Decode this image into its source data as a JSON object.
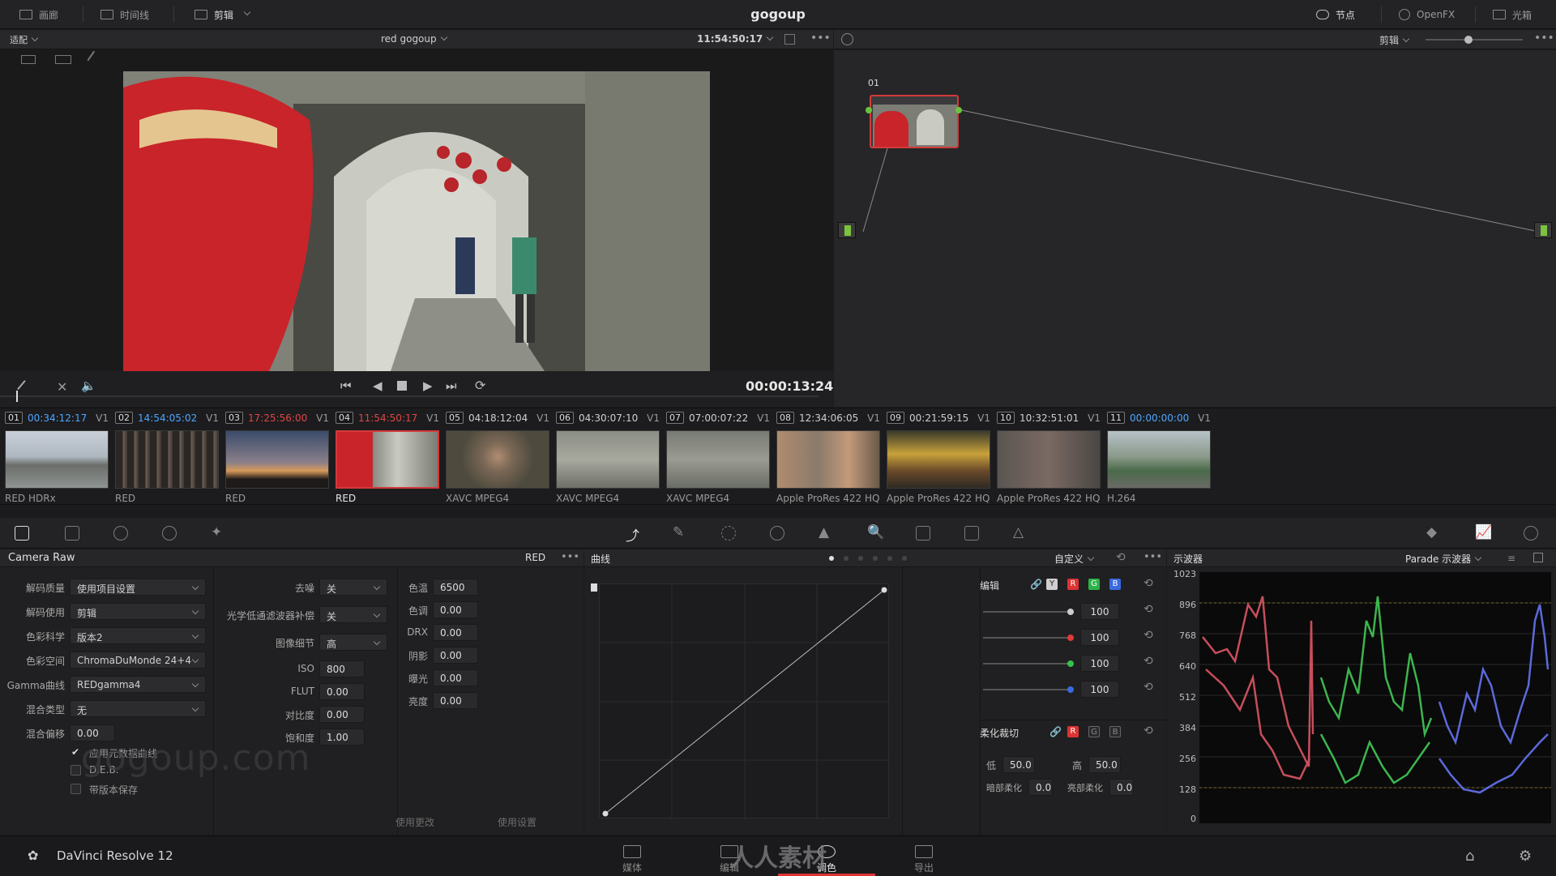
{
  "top_bar": {
    "app_title": "gogoup",
    "left_items": [
      "画廊",
      "时间线"
    ],
    "page_dropdown": "剪辑",
    "right_items": [
      "节点",
      "OpenFX",
      "光箱"
    ]
  },
  "viewer_bar": {
    "fit_label": "适配",
    "clip_name": "red gogoup",
    "timecode": "11:54:50:17"
  },
  "node_bar": {
    "mode_label": "剪辑"
  },
  "node": {
    "label": "01"
  },
  "transport": {
    "timecode": "00:00:13:24"
  },
  "clips": [
    {
      "num": "01",
      "tc": "00:34:12:17",
      "track": "V1",
      "codec": "RED HDRx",
      "tc_color": "#4da6ff"
    },
    {
      "num": "02",
      "tc": "14:54:05:02",
      "track": "V1",
      "codec": "RED",
      "tc_color": "#4da6ff"
    },
    {
      "num": "03",
      "tc": "17:25:56:00",
      "track": "V1",
      "codec": "RED",
      "tc_color": "#e04545"
    },
    {
      "num": "04",
      "tc": "11:54:50:17",
      "track": "V1",
      "codec": "RED",
      "tc_color": "#e04545"
    },
    {
      "num": "05",
      "tc": "04:18:12:04",
      "track": "V1",
      "codec": "XAVC MPEG4",
      "tc_color": "#cfcfcf"
    },
    {
      "num": "06",
      "tc": "04:30:07:10",
      "track": "V1",
      "codec": "XAVC MPEG4",
      "tc_color": "#cfcfcf"
    },
    {
      "num": "07",
      "tc": "07:00:07:22",
      "track": "V1",
      "codec": "XAVC MPEG4",
      "tc_color": "#cfcfcf"
    },
    {
      "num": "08",
      "tc": "12:34:06:05",
      "track": "V1",
      "codec": "Apple ProRes 422 HQ",
      "tc_color": "#cfcfcf"
    },
    {
      "num": "09",
      "tc": "00:21:59:15",
      "track": "V1",
      "codec": "Apple ProRes 422 HQ",
      "tc_color": "#cfcfcf"
    },
    {
      "num": "10",
      "tc": "10:32:51:01",
      "track": "V1",
      "codec": "Apple ProRes 422 HQ",
      "tc_color": "#cfcfcf"
    },
    {
      "num": "11",
      "tc": "00:00:00:00",
      "track": "V1",
      "codec": "H.264",
      "tc_color": "#4da6ff"
    }
  ],
  "camera_raw": {
    "title": "Camera Raw",
    "format": "RED",
    "col1": [
      {
        "label": "解码质量",
        "value": "使用项目设置"
      },
      {
        "label": "解码使用",
        "value": "剪辑"
      },
      {
        "label": "色彩科学",
        "value": "版本2"
      },
      {
        "label": "色彩空间",
        "value": "ChromaDuMonde 24+4"
      },
      {
        "label": "Gamma曲线",
        "value": "REDgamma4"
      },
      {
        "label": "混合类型",
        "value": "无"
      }
    ],
    "mix_offset_label": "混合偏移",
    "mix_offset_value": "0.00",
    "checkboxes": [
      "应用元数据曲线",
      "D.E.B.",
      "带版本保存"
    ],
    "col2_selects": [
      {
        "label": "去噪",
        "value": "关"
      },
      {
        "label": "光学低通滤波器补偿",
        "value": "关"
      },
      {
        "label": "图像细节",
        "value": "高"
      }
    ],
    "col2_nums": [
      {
        "label": "ISO",
        "value": "800"
      },
      {
        "label": "FLUT",
        "value": "0.00"
      },
      {
        "label": "对比度",
        "value": "0.00"
      },
      {
        "label": "饱和度",
        "value": "1.00"
      }
    ],
    "col3_nums": [
      {
        "label": "色温",
        "value": "6500"
      },
      {
        "label": "色调",
        "value": "0.00"
      },
      {
        "label": "DRX",
        "value": "0.00"
      },
      {
        "label": "阴影",
        "value": "0.00"
      },
      {
        "label": "曝光",
        "value": "0.00"
      },
      {
        "label": "亮度",
        "value": "0.00"
      }
    ],
    "use_changes": "使用更改",
    "use_settings": "使用设置"
  },
  "curves": {
    "title": "曲线",
    "mode": "自定义",
    "edit_label": "编辑",
    "channels": [
      "Y",
      "R",
      "G",
      "B"
    ],
    "sliders": [
      {
        "value": "100",
        "color": "#cccccc"
      },
      {
        "value": "100",
        "color": "#e03a3a"
      },
      {
        "value": "100",
        "color": "#35c24a"
      },
      {
        "value": "100",
        "color": "#3a6ae0"
      }
    ],
    "soft_clip_label": "柔化裁切",
    "soft_channels": [
      "R",
      "G",
      "B"
    ],
    "low_label": "低",
    "low_value": "50.0",
    "high_label": "高",
    "high_value": "50.0",
    "low_soft_label": "暗部柔化",
    "low_soft_value": "0.0",
    "high_soft_label": "亮部柔化",
    "high_soft_value": "0.0"
  },
  "scope": {
    "title": "示波器",
    "mode": "Parade 示波器",
    "ticks": [
      "1023",
      "896",
      "768",
      "640",
      "512",
      "384",
      "256",
      "128",
      "0"
    ]
  },
  "bottom": {
    "product": "DaVinci Resolve 12",
    "pages": [
      "媒体",
      "编辑",
      "调色",
      "导出"
    ],
    "active_page": "调色"
  },
  "watermarks": {
    "site": "gogoup.com",
    "brand": "人人素材"
  }
}
